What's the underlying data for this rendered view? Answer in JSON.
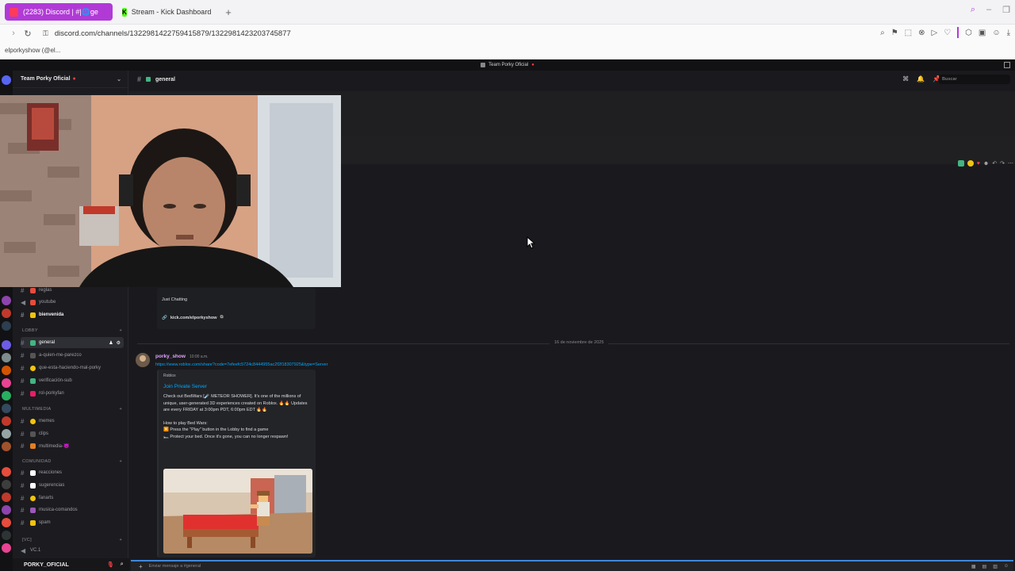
{
  "browser": {
    "tabs": [
      {
        "label": "(2283) Discord | #|⁠🌐ge",
        "active": true,
        "favicon_color": "#ff3b5c"
      },
      {
        "label": "Stream - Kick Dashboard",
        "active": false,
        "favicon_color": "#53fc18",
        "favicon_text": "K"
      }
    ],
    "url": "discord.com/channels/1322981422759415879/1322981423203745877",
    "bookmark": "elporkyshow (@el..."
  },
  "discord": {
    "window_title": "Team Porky Oficial",
    "server_name": "Team Porky Oficial",
    "channel_name": "general",
    "search_placeholder": "Buscar",
    "channels_top": [
      {
        "name": "reglas",
        "emoji_color": "#e74c3c"
      },
      {
        "name": "youtube",
        "emoji_color": "#e74c3c"
      },
      {
        "name": "bienvenida",
        "emoji_color": "#f1c40f",
        "bold": true
      }
    ],
    "category_lobby": "LOBBY",
    "channels_lobby": [
      {
        "name": "general",
        "emoji_color": "#43b581",
        "active": true
      },
      {
        "name": "a-quien-me-parezco",
        "emoji_color": ""
      },
      {
        "name": "que-esta-haciendo-mal-porky",
        "emoji_color": "#f1c40f"
      },
      {
        "name": "verificación-sub",
        "emoji_color": "#43b581"
      },
      {
        "name": "rol-porkyfan",
        "emoji_color": "#e91e63"
      }
    ],
    "category_multimedia": "MULTIMEDIA",
    "channels_multimedia": [
      {
        "name": "memes",
        "emoji_color": "#f1c40f"
      },
      {
        "name": "clips",
        "emoji_color": ""
      },
      {
        "name": "multimedia-😈",
        "emoji_color": "#e67e22"
      }
    ],
    "category_comunidad": "COMUNIDAD",
    "channels_comunidad": [
      {
        "name": "reacciones",
        "emoji_color": "#ffffff"
      },
      {
        "name": "sugerencias",
        "emoji_color": "#ffffff"
      },
      {
        "name": "fanarts",
        "emoji_color": "#f1c40f"
      },
      {
        "name": "musica-comandos",
        "emoji_color": "#9b59b6"
      },
      {
        "name": "spam",
        "emoji_color": "#f1c40f"
      }
    ],
    "category_vc": "[VC]",
    "voice_channel": "VC.1",
    "username": "PORKY_OFICIAL",
    "embed_top": {
      "label": "Just Chatting",
      "link": "kick.com/elporkyshow"
    },
    "date_divider": "16 de noviembre de 2025",
    "message": {
      "author": "porky_show",
      "time": "10:00 a.m.",
      "link": "https://www.roblox.com/share?code=7efeefc5724c8444955ac2f2f18307925&type=Server",
      "embed": {
        "provider": "Roblox",
        "title": "Join Private Server",
        "desc1": "Check out BedWars [☄️ METEOR SHOWER]. It's one of the millions of unique, user-generated 3D experiences created on Roblox. 🔥🔥 Updates are every FRIDAY at 3:00pm PDT, 6:00pm EDT 🔥🔥",
        "desc2": "How to play Bed Wars:",
        "desc3": "▶️ Press the \"Play\" button in the Lobby to find a game",
        "desc4": "🛏️ Protect your bed. Once it's gone, you can no longer respawn!"
      }
    },
    "composer_placeholder": "Enviar mensaje a #general"
  },
  "colors": {
    "accent": "#b13ad6",
    "link": "#00a8fc",
    "author": "#e2a4ff"
  }
}
